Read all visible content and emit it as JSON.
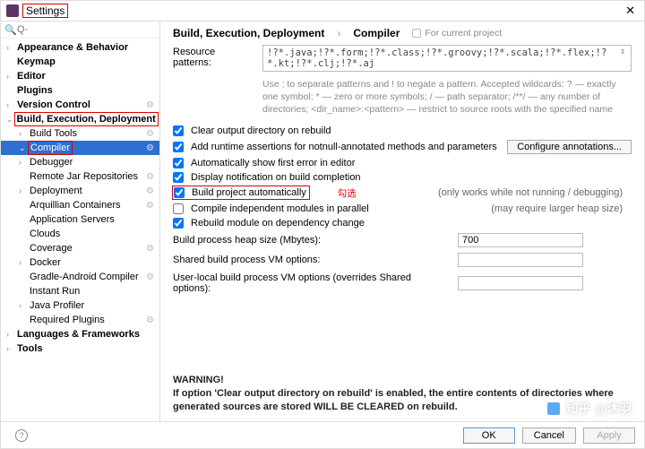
{
  "window": {
    "title": "Settings",
    "close": "✕"
  },
  "search": {
    "placeholder": "Q-",
    "icon": "🔍"
  },
  "tree": {
    "items": [
      {
        "label": "Appearance & Behavior",
        "level": 0,
        "bold": true,
        "tw": "›"
      },
      {
        "label": "Keymap",
        "level": 0,
        "bold": true,
        "tw": ""
      },
      {
        "label": "Editor",
        "level": 0,
        "bold": true,
        "tw": "›"
      },
      {
        "label": "Plugins",
        "level": 0,
        "bold": true,
        "tw": ""
      },
      {
        "label": "Version Control",
        "level": 0,
        "bold": true,
        "tw": "›",
        "gear": true
      },
      {
        "label": "Build, Execution, Deployment",
        "level": 0,
        "bold": true,
        "tw": "⌄",
        "redbox": true
      },
      {
        "label": "Build Tools",
        "level": 1,
        "tw": "›",
        "gear": true
      },
      {
        "label": "Compiler",
        "level": 1,
        "tw": "⌄",
        "selected": true,
        "gear": true,
        "redbox": true
      },
      {
        "label": "Debugger",
        "level": 1,
        "tw": "›"
      },
      {
        "label": "Remote Jar Repositories",
        "level": 1,
        "tw": "",
        "gear": true
      },
      {
        "label": "Deployment",
        "level": 1,
        "tw": "›",
        "gear": true
      },
      {
        "label": "Arquillian Containers",
        "level": 1,
        "tw": "",
        "gear": true
      },
      {
        "label": "Application Servers",
        "level": 1,
        "tw": ""
      },
      {
        "label": "Clouds",
        "level": 1,
        "tw": ""
      },
      {
        "label": "Coverage",
        "level": 1,
        "tw": "",
        "gear": true
      },
      {
        "label": "Docker",
        "level": 1,
        "tw": "›"
      },
      {
        "label": "Gradle-Android Compiler",
        "level": 1,
        "tw": "",
        "gear": true
      },
      {
        "label": "Instant Run",
        "level": 1,
        "tw": ""
      },
      {
        "label": "Java Profiler",
        "level": 1,
        "tw": "›"
      },
      {
        "label": "Required Plugins",
        "level": 1,
        "tw": "",
        "gear": true
      },
      {
        "label": "Languages & Frameworks",
        "level": 0,
        "bold": true,
        "tw": "›"
      },
      {
        "label": "Tools",
        "level": 0,
        "bold": true,
        "tw": "›"
      }
    ]
  },
  "breadcrumb": {
    "a": "Build, Execution, Deployment",
    "sep": "›",
    "b": "Compiler",
    "hint": "For current project"
  },
  "patterns": {
    "label": "Resource patterns:",
    "value": "!?*.java;!?*.form;!?*.class;!?*.groovy;!?*.scala;!?*.flex;!?*.kt;!?*.clj;!?*.aj",
    "help": "Use ; to separate patterns and ! to negate a pattern. Accepted wildcards: ? — exactly one symbol; * — zero or more symbols; / — path separator; /**/ — any number of directories; <dir_name>:<pattern> — restrict to source roots with the specified name"
  },
  "checks": [
    {
      "label": "Clear output directory on rebuild",
      "checked": true
    },
    {
      "label": "Add runtime assertions for notnull-annotated methods and parameters",
      "checked": true,
      "btn": "Configure annotations..."
    },
    {
      "label": "Automatically show first error in editor",
      "checked": true
    },
    {
      "label": "Display notification on build completion",
      "checked": true
    },
    {
      "label": "Build project automatically",
      "checked": true,
      "red": true,
      "anno": "勾选",
      "note": "(only works while not running / debugging)"
    },
    {
      "label": "Compile independent modules in parallel",
      "checked": false,
      "note": "(may require larger heap size)"
    },
    {
      "label": "Rebuild module on dependency change",
      "checked": true
    }
  ],
  "fields": {
    "heap": {
      "label": "Build process heap size (Mbytes):",
      "value": "700"
    },
    "shared": {
      "label": "Shared build process VM options:",
      "value": ""
    },
    "user": {
      "label": "User-local build process VM options (overrides Shared options):",
      "value": ""
    }
  },
  "warning": {
    "h": "WARNING!",
    "t": "If option 'Clear output directory on rebuild' is enabled, the entire contents of directories where generated sources are stored WILL BE CLEARED on rebuild."
  },
  "footer": {
    "ok": "OK",
    "cancel": "Cancel",
    "apply": "Apply",
    "help": "?"
  },
  "watermark": "知乎 @沐羽"
}
